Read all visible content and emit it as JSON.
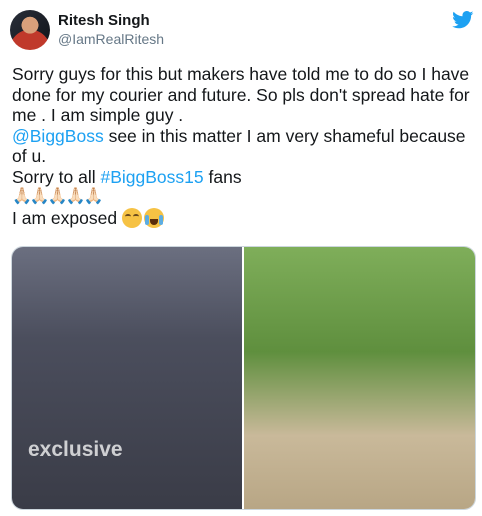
{
  "tweet": {
    "author_name": "Ritesh Singh",
    "author_handle": "@IamRealRitesh",
    "line1": "Sorry guys for this but makers have told me to do so I have done for my courier and future. So pls don't spread hate for me . I am simple guy  .",
    "mention": "@BiggBoss",
    "line2": "  see in this matter I am very shameful because of u.",
    "line3_prefix": "Sorry to all ",
    "hashtag": "#BiggBoss15",
    "line3_suffix": "  fans",
    "hands": "🙏🏻🙏🏻🙏🏻🙏🏻🙏🏻",
    "line4": "I am exposed "
  },
  "media": {
    "left_caption": "exclusive"
  },
  "colors": {
    "link": "#1da1f2",
    "text": "#14171a",
    "muted": "#657786"
  },
  "icons": {
    "logo": "twitter-bird-icon"
  }
}
